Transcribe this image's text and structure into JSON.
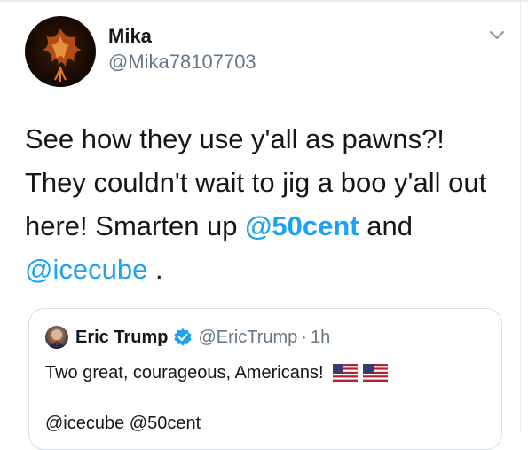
{
  "tweet": {
    "author": {
      "display_name": "Mika",
      "handle": "@Mika78107703"
    },
    "text_part1": "See how they use y'all as pawns?! They couldn't wait to jig a boo y'all out here! Smarten up ",
    "mention1": "@50cent",
    "text_part2": " and ",
    "mention2": "@icecube",
    "text_part3": " ."
  },
  "quoted_tweet": {
    "display_name": "Eric Trump",
    "handle": "@EricTrump",
    "separator": "·",
    "time": "1h",
    "text": "Two great, courageous, Americans!",
    "mentions": "@icecube @50cent"
  },
  "icons": [
    "chevron-down-icon",
    "verified-badge-icon",
    "us-flag-icon"
  ],
  "colors": {
    "link": "#1da1f2",
    "secondary_text": "#657786",
    "primary_text": "#14171a"
  }
}
